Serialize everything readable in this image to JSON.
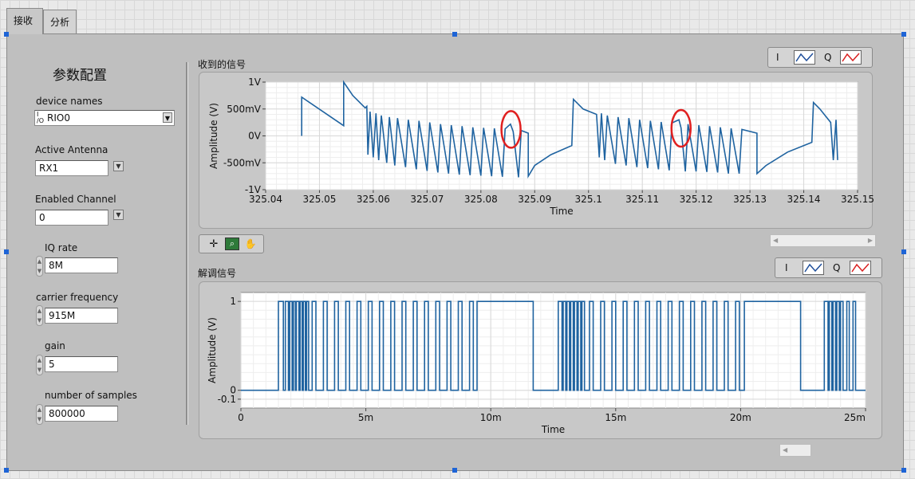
{
  "tabs": [
    "接收",
    "分析"
  ],
  "config": {
    "title": "参数配置",
    "device_names": {
      "label": "device names",
      "prefix": "I/O",
      "value": "RIO0"
    },
    "active_antenna": {
      "label": "Active Antenna",
      "value": "RX1"
    },
    "enabled_channel": {
      "label": "Enabled Channel",
      "value": "0"
    },
    "iq_rate": {
      "label": "IQ rate",
      "value": "8M"
    },
    "carrier_frequency": {
      "label": "carrier frequency",
      "value": "915M"
    },
    "gain": {
      "label": "gain",
      "value": "5"
    },
    "num_samples": {
      "label": "number of samples",
      "value": "800000"
    }
  },
  "legend": {
    "i": "I",
    "q": "Q",
    "i_color": "#1f4e9a",
    "q_color": "#d92020"
  },
  "colors": {
    "trace": "#1f63a0",
    "annotation": "#e02020",
    "plot_bg": "#ffffff",
    "panel": "#bfbfbf"
  },
  "chart_data": [
    {
      "type": "line",
      "title": "收到的信号",
      "xlabel": "Time",
      "ylabel": "Amplitude (V)",
      "xlim": [
        325.04,
        325.15
      ],
      "ylim": [
        -1,
        1
      ],
      "xticks": [
        "325.04",
        "325.05",
        "325.06",
        "325.07",
        "325.08",
        "325.09",
        "325.1",
        "325.11",
        "325.12",
        "325.13",
        "325.14",
        "325.15"
      ],
      "yticks": [
        {
          "v": 1,
          "t": "1V"
        },
        {
          "v": 0.5,
          "t": "500mV"
        },
        {
          "v": 0,
          "t": "0V"
        },
        {
          "v": -0.5,
          "t": "-500mV"
        },
        {
          "v": -1,
          "t": "-1V"
        }
      ],
      "grid": true,
      "series": [
        {
          "points": [
            [
              325.0467,
              0.0
            ],
            [
              325.0467,
              0.72
            ],
            [
              325.0545,
              0.19
            ],
            [
              325.0545,
              1.0
            ],
            [
              325.0562,
              0.75
            ],
            [
              325.0585,
              0.52
            ],
            [
              325.0588,
              0.55
            ],
            [
              325.059,
              -0.35
            ],
            [
              325.0594,
              0.45
            ],
            [
              325.06,
              -0.4
            ],
            [
              325.0605,
              0.42
            ],
            [
              325.061,
              -0.45
            ],
            [
              325.0615,
              0.38
            ],
            [
              325.0625,
              -0.5
            ],
            [
              325.063,
              0.35
            ],
            [
              325.064,
              -0.55
            ],
            [
              325.0645,
              0.33
            ],
            [
              325.066,
              -0.58
            ],
            [
              325.0665,
              0.3
            ],
            [
              325.068,
              -0.62
            ],
            [
              325.0685,
              0.28
            ],
            [
              325.07,
              -0.65
            ],
            [
              325.0705,
              0.25
            ],
            [
              325.072,
              -0.68
            ],
            [
              325.0725,
              0.22
            ],
            [
              325.074,
              -0.7
            ],
            [
              325.0745,
              0.2
            ],
            [
              325.076,
              -0.72
            ],
            [
              325.0765,
              0.18
            ],
            [
              325.078,
              -0.73
            ],
            [
              325.0785,
              0.16
            ],
            [
              325.08,
              -0.74
            ],
            [
              325.0805,
              0.15
            ],
            [
              325.082,
              -0.75
            ],
            [
              325.0825,
              0.14
            ],
            [
              325.084,
              -0.76
            ],
            [
              325.0845,
              0.13
            ],
            [
              325.0855,
              0.22
            ],
            [
              325.086,
              0.08
            ],
            [
              325.087,
              -0.77
            ],
            [
              325.0875,
              0.1
            ],
            [
              325.0888,
              0.05
            ],
            [
              325.0888,
              -0.75
            ],
            [
              325.09,
              -0.55
            ],
            [
              325.093,
              -0.35
            ],
            [
              325.0969,
              -0.18
            ],
            [
              325.0972,
              0.68
            ],
            [
              325.099,
              0.5
            ],
            [
              325.1015,
              0.4
            ],
            [
              325.102,
              -0.4
            ],
            [
              325.1024,
              0.42
            ],
            [
              325.103,
              -0.45
            ],
            [
              325.1035,
              0.38
            ],
            [
              325.105,
              -0.52
            ],
            [
              325.1055,
              0.35
            ],
            [
              325.107,
              -0.55
            ],
            [
              325.1075,
              0.33
            ],
            [
              325.109,
              -0.58
            ],
            [
              325.1095,
              0.3
            ],
            [
              325.111,
              -0.6
            ],
            [
              325.1115,
              0.28
            ],
            [
              325.113,
              -0.62
            ],
            [
              325.1135,
              0.26
            ],
            [
              325.115,
              -0.64
            ],
            [
              325.1155,
              0.24
            ],
            [
              325.1168,
              0.3
            ],
            [
              325.1172,
              0.15
            ],
            [
              325.118,
              -0.66
            ],
            [
              325.1185,
              0.22
            ],
            [
              325.12,
              -0.66
            ],
            [
              325.1205,
              0.2
            ],
            [
              325.122,
              -0.67
            ],
            [
              325.1225,
              0.18
            ],
            [
              325.124,
              -0.68
            ],
            [
              325.1245,
              0.16
            ],
            [
              325.126,
              -0.7
            ],
            [
              325.1265,
              0.14
            ],
            [
              325.128,
              -0.7
            ],
            [
              325.1285,
              0.12
            ],
            [
              325.1313,
              0.05
            ],
            [
              325.1313,
              -0.7
            ],
            [
              325.133,
              -0.55
            ],
            [
              325.137,
              -0.3
            ],
            [
              325.1415,
              -0.12
            ],
            [
              325.1418,
              0.62
            ],
            [
              325.143,
              0.5
            ],
            [
              325.1438,
              0.4
            ],
            [
              325.145,
              0.25
            ],
            [
              325.1455,
              -0.45
            ],
            [
              325.146,
              0.3
            ],
            [
              325.1463,
              -0.45
            ]
          ]
        }
      ],
      "annotations": [
        {
          "type": "ellipse",
          "x": 325.0856,
          "y": 0.12
        },
        {
          "type": "ellipse",
          "x": 325.1172,
          "y": 0.14
        }
      ]
    },
    {
      "type": "line",
      "title": "解调信号",
      "xlabel": "Time",
      "ylabel": "Amplitude (V)",
      "xlim": [
        0,
        25
      ],
      "ylim": [
        -0.2,
        1.1
      ],
      "xticks": [
        {
          "v": 0,
          "t": "0"
        },
        {
          "v": 5,
          "t": "5m"
        },
        {
          "v": 10,
          "t": "10m"
        },
        {
          "v": 15,
          "t": "15m"
        },
        {
          "v": 20,
          "t": "20m"
        },
        {
          "v": 25,
          "t": "25m"
        }
      ],
      "yticks": [
        {
          "v": 1,
          "t": "1"
        },
        {
          "v": 0,
          "t": "0"
        },
        {
          "v": -0.1,
          "t": "-0.1"
        }
      ],
      "grid": true,
      "series": [
        {
          "pulses": [
            [
              1.5,
              1.7
            ],
            [
              1.78,
              1.9
            ],
            [
              1.95,
              2.05
            ],
            [
              2.1,
              2.18
            ],
            [
              2.22,
              2.32
            ],
            [
              2.37,
              2.45
            ],
            [
              2.5,
              2.58
            ],
            [
              2.63,
              2.71
            ],
            [
              2.85,
              3.0
            ],
            [
              3.3,
              3.45
            ],
            [
              3.75,
              3.9
            ],
            [
              4.2,
              4.35
            ],
            [
              4.65,
              4.8
            ],
            [
              5.1,
              5.25
            ],
            [
              5.55,
              5.7
            ],
            [
              6.0,
              6.15
            ],
            [
              6.45,
              6.6
            ],
            [
              6.9,
              7.05
            ],
            [
              7.35,
              7.5
            ],
            [
              7.8,
              7.95
            ],
            [
              8.25,
              8.4
            ],
            [
              8.7,
              8.85
            ],
            [
              9.15,
              9.3
            ],
            [
              9.45,
              11.7
            ],
            [
              12.7,
              12.85
            ],
            [
              12.9,
              13.0
            ],
            [
              13.05,
              13.15
            ],
            [
              13.2,
              13.3
            ],
            [
              13.35,
              13.45
            ],
            [
              13.5,
              13.6
            ],
            [
              13.65,
              13.75
            ],
            [
              13.95,
              14.1
            ],
            [
              14.4,
              14.55
            ],
            [
              14.85,
              15.0
            ],
            [
              15.3,
              15.45
            ],
            [
              15.75,
              15.9
            ],
            [
              16.2,
              16.35
            ],
            [
              16.65,
              16.8
            ],
            [
              17.1,
              17.25
            ],
            [
              17.55,
              17.7
            ],
            [
              18.0,
              18.15
            ],
            [
              18.45,
              18.6
            ],
            [
              18.9,
              19.05
            ],
            [
              19.35,
              19.5
            ],
            [
              19.8,
              19.95
            ],
            [
              20.15,
              22.4
            ],
            [
              23.35,
              23.5
            ],
            [
              23.55,
              23.65
            ],
            [
              23.7,
              23.8
            ],
            [
              23.85,
              23.95
            ],
            [
              24.0,
              24.1
            ],
            [
              24.25,
              24.35
            ],
            [
              24.5,
              24.6
            ]
          ]
        }
      ]
    }
  ]
}
